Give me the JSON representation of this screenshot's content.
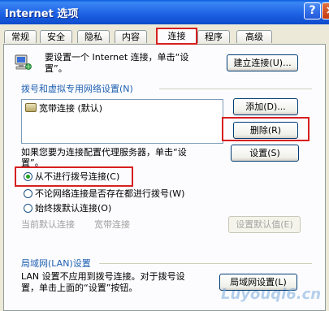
{
  "window": {
    "title": "Internet 选项",
    "help_glyph": "?",
    "close_glyph": "×"
  },
  "tabs": [
    {
      "label": "常规",
      "active": false
    },
    {
      "label": "安全",
      "active": false
    },
    {
      "label": "隐私",
      "active": false
    },
    {
      "label": "内容",
      "active": false
    },
    {
      "label": "连接",
      "active": true
    },
    {
      "label": "程序",
      "active": false
    },
    {
      "label": "高级",
      "active": false
    }
  ],
  "setup": {
    "text_line1": "要设置一个 Internet 连接，单击“设",
    "text_line2": "置”。",
    "button": "建立连接(U)..."
  },
  "dialup": {
    "group_label": "拨号和虚拟专用网络设置(N)",
    "items": [
      "宽带连接 (默认)"
    ],
    "add_button": "添加(D)...",
    "remove_button": "删除(R)",
    "proxy_text_line1": "如果您要为连接配置代理服务器，单击“设",
    "proxy_text_line2": "置”。",
    "settings_button": "设置(S)",
    "options": [
      {
        "label": "从不进行拨号连接(C)",
        "checked": true
      },
      {
        "label": "不论网络连接是否存在都进行拨号(W)",
        "checked": false
      },
      {
        "label": "始终拨默认连接(O)",
        "checked": false
      }
    ],
    "current_default_label": "当前默认连接",
    "current_default_value": "宽带连接",
    "default_settings_button": "设置默认值(E)"
  },
  "lan": {
    "group_label": "局域网(LAN)设置",
    "text_line1": "LAN 设置不应用到拨号连接。对于拨号设",
    "text_line2": "置，单击上面的“设置”按钮。",
    "button": "局域网设置(L)"
  },
  "watermark": "Luyouqi6.cn"
}
